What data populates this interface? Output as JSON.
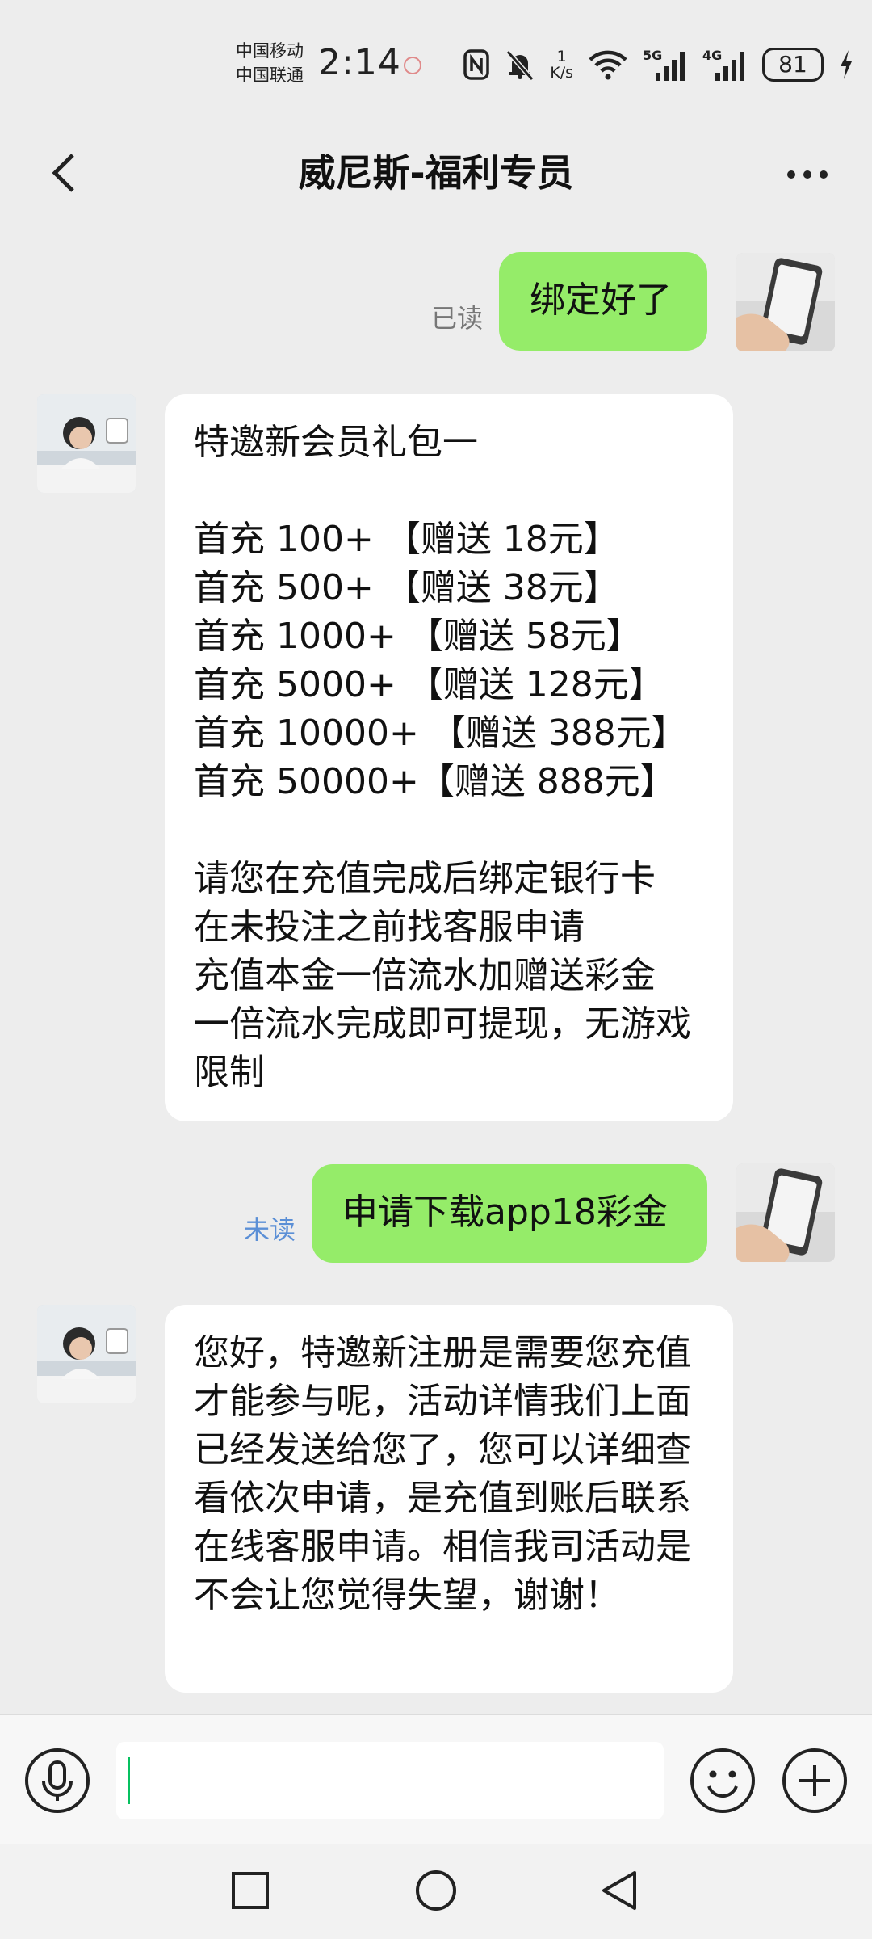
{
  "status_bar": {
    "carrier_1": "中国移动",
    "carrier_2": "中国联通",
    "time": "2:14",
    "speed_value": "1",
    "speed_unit": "K/s",
    "net_1": "5G",
    "net_2": "4G",
    "battery": "81"
  },
  "header": {
    "title": "威尼斯-福利专员"
  },
  "messages": [
    {
      "direction": "out",
      "text": "绑定好了",
      "status": "已读"
    },
    {
      "direction": "in",
      "text": "特邀新会员礼包一\n\n首充 100+ 【赠送 18元】\n首充 500+ 【赠送 38元】\n首充 1000+ 【赠送 58元】\n首充 5000+ 【赠送 128元】\n首充 10000+ 【赠送 388元】\n首充 50000+【赠送 888元】\n\n请您在充值完成后绑定银行卡\n在未投注之前找客服申请\n充值本金一倍流水加赠送彩金\n一倍流水完成即可提现，无游戏限制"
    },
    {
      "direction": "out",
      "text": "申请下载app18彩金",
      "status": "未读"
    },
    {
      "direction": "in",
      "text": "您好，特邀新注册是需要您充值才能参与呢，活动详情我们上面已经发送给您了，您可以详细查看依次申请，是充值到账后联系在线客服申请。相信我司活动是不会让您觉得失望，谢谢！"
    }
  ],
  "colors": {
    "background": "#ededed",
    "outgoing_bubble": "#95ec69",
    "incoming_bubble": "#ffffff",
    "read_status": "#777777",
    "unread_status": "#5b8fd6",
    "caret": "#07c160"
  },
  "icons": {
    "back": "back-arrow-icon",
    "more": "more-dots-icon",
    "voice": "microphone-icon",
    "emoji": "smiley-icon",
    "plus": "plus-icon",
    "nav_recents": "square-icon",
    "nav_home": "circle-icon",
    "nav_back": "triangle-back-icon"
  }
}
